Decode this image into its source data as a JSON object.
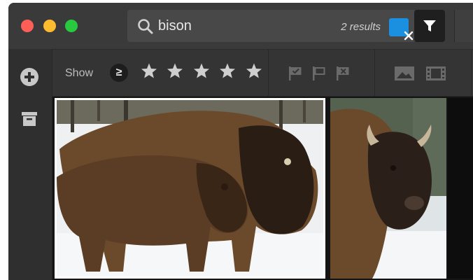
{
  "search": {
    "query": "bison",
    "results": "2 results"
  },
  "icons": {
    "search": "search-icon",
    "clear": "close-icon",
    "filter": "filter-icon",
    "add": "plus-circle-icon",
    "archive": "archive-icon",
    "flagged": "flag-check-icon",
    "unflagged": "flag-icon",
    "rejected": "flag-x-icon",
    "photos": "photo-icon",
    "videos": "film-icon"
  },
  "filters": {
    "show_label": "Show",
    "rating_operator": "≥",
    "rating_stars": 5
  },
  "colors": {
    "accent": "#1b8fe0",
    "window_bg": "#323232",
    "toolbar_bg": "#343434",
    "icon": "#c8c8c8",
    "icon_dim": "#6a6a6a"
  }
}
